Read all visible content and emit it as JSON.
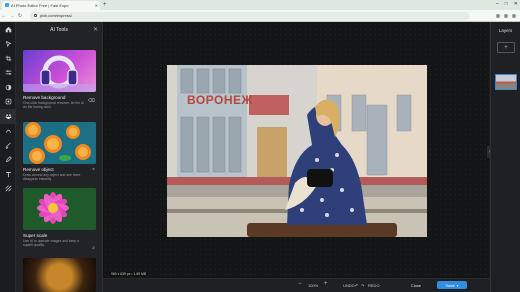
{
  "browser": {
    "tab_title": "AI Photo Editor Free | Fast Expo",
    "url": "pixlr.com/express/",
    "close_glyph": "✕",
    "new_tab_glyph": "+"
  },
  "panel": {
    "title": "AI Tools",
    "close_glyph": "✕",
    "cards": [
      {
        "title": "Remove background",
        "desc": "One-click background remover, let the AI do the boring work."
      },
      {
        "title": "Remove object",
        "desc": "Draw around any object and see them disappear instantly."
      },
      {
        "title": "Super scale",
        "desc": "Use AI to upscale images and keep a superb quality."
      }
    ]
  },
  "canvas": {
    "size_label": "960 x 639 px  •  1.69 MB",
    "sign_text": "ВОРОНЕЖ"
  },
  "layers": {
    "title": "Layers",
    "add_glyph": "+"
  },
  "bottombar": {
    "zoom_minus": "−",
    "zoom_value": "100%",
    "zoom_plus": "+",
    "undo_label": "UNDO",
    "redo_label": "REDO",
    "close_label": "Close",
    "save_label": "Save"
  },
  "colors": {
    "accent": "#2f8ee0",
    "panel_bg": "#222327",
    "workspace_bg": "#141517"
  }
}
